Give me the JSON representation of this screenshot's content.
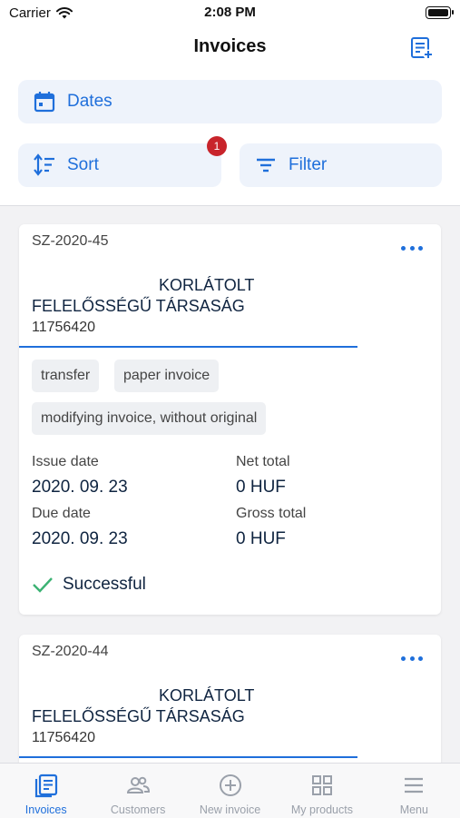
{
  "status_bar": {
    "carrier": "Carrier",
    "time": "2:08 PM"
  },
  "header": {
    "title": "Invoices"
  },
  "toolbar": {
    "dates_label": "Dates",
    "sort_label": "Sort",
    "sort_badge": "1",
    "filter_label": "Filter"
  },
  "invoices": [
    {
      "number": "SZ-2020-45",
      "company_line1": "KORLÁTOLT",
      "company_line2": "FELELŐSSÉGŰ TÁRSASÁG",
      "tax_number": "11756420",
      "tags": [
        "transfer",
        "paper invoice",
        "modifying invoice, without original"
      ],
      "issue_date_label": "Issue date",
      "issue_date": "2020. 09. 23",
      "net_total_label": "Net total",
      "net_total": "0 HUF",
      "due_date_label": "Due date",
      "due_date": "2020. 09. 23",
      "gross_total_label": "Gross total",
      "gross_total": "0 HUF",
      "status": "Successful",
      "status_color": "#3bb273"
    },
    {
      "number": "SZ-2020-44",
      "company_line1": "KORLÁTOLT",
      "company_line2": "FELELŐSSÉGŰ TÁRSASÁG",
      "tax_number": "11756420"
    }
  ],
  "tabs": [
    {
      "label": "Invoices",
      "icon": "invoices-icon",
      "active": true
    },
    {
      "label": "Customers",
      "icon": "customers-icon"
    },
    {
      "label": "New invoice",
      "icon": "plus-circle-icon"
    },
    {
      "label": "My products",
      "icon": "grid-icon"
    },
    {
      "label": "Menu",
      "icon": "menu-icon"
    }
  ],
  "colors": {
    "accent": "#1f6fdb",
    "badge": "#c8242b",
    "success": "#3bb273"
  }
}
